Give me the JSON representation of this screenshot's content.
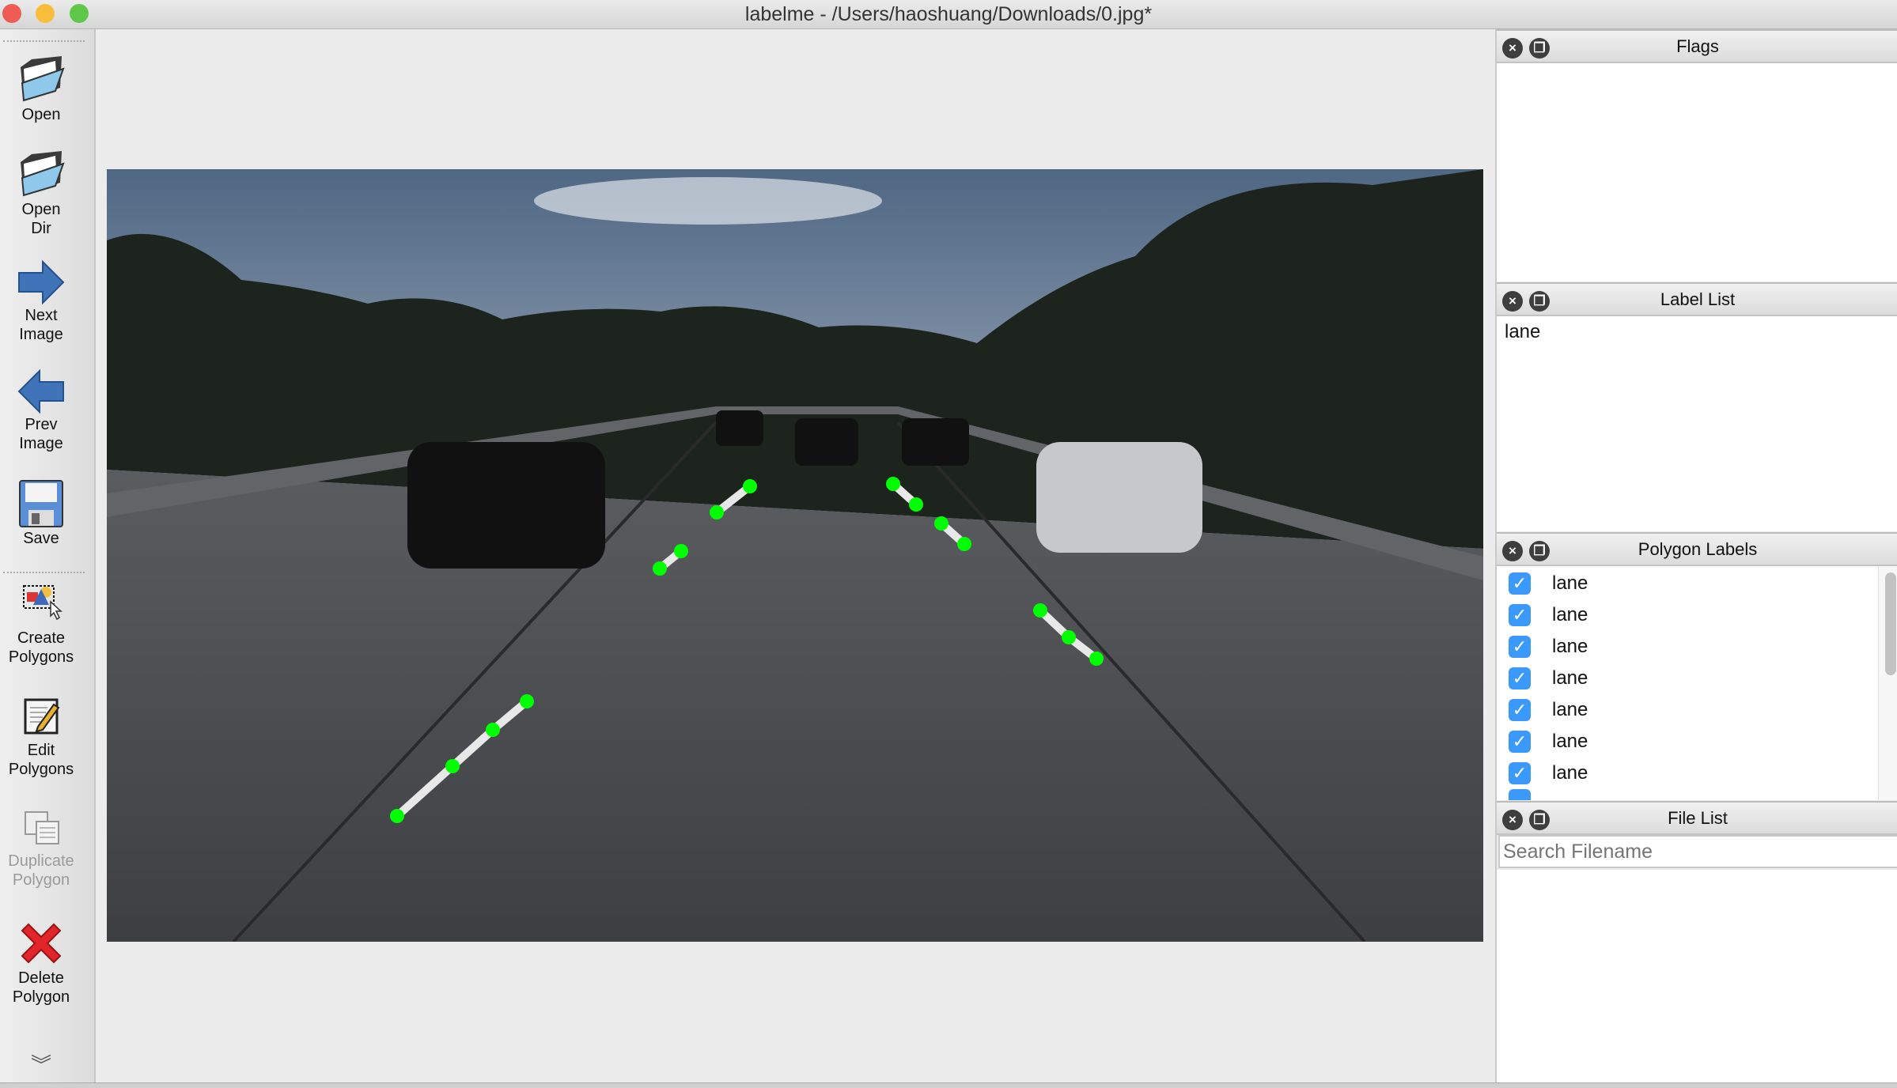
{
  "window": {
    "title": "labelme - /Users/haoshuang/Downloads/0.jpg*"
  },
  "toolbar": {
    "open": "Open",
    "open_dir_1": "Open",
    "open_dir_2": "Dir",
    "next_1": "Next",
    "next_2": "Image",
    "prev_1": "Prev",
    "prev_2": "Image",
    "save": "Save",
    "create_1": "Create",
    "create_2": "Polygons",
    "edit_1": "Edit",
    "edit_2": "Polygons",
    "dup_1": "Duplicate",
    "dup_2": "Polygon",
    "del_1": "Delete",
    "del_2": "Polygon"
  },
  "docks": {
    "flags": {
      "title": "Flags"
    },
    "label_list": {
      "title": "Label List",
      "items": [
        "lane"
      ]
    },
    "polygon_labels": {
      "title": "Polygon Labels",
      "items": [
        {
          "label": "lane",
          "checked": true
        },
        {
          "label": "lane",
          "checked": true
        },
        {
          "label": "lane",
          "checked": true
        },
        {
          "label": "lane",
          "checked": true
        },
        {
          "label": "lane",
          "checked": true
        },
        {
          "label": "lane",
          "checked": true
        },
        {
          "label": "lane",
          "checked": true
        }
      ]
    },
    "file_list": {
      "title": "File List",
      "search_placeholder": "Search Filename"
    }
  },
  "colors": {
    "accent": "#3b99fc",
    "point": "#00ff00"
  }
}
